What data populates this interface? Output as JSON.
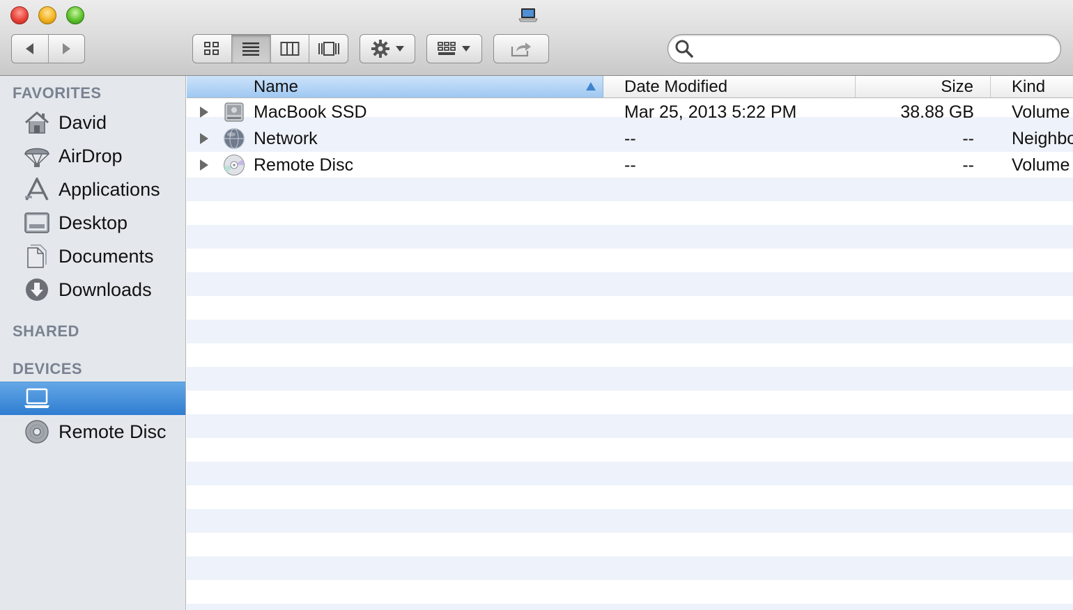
{
  "window": {
    "title_icon": "laptop-icon",
    "buttons": [
      "close",
      "minimize",
      "zoom"
    ]
  },
  "toolbar": {
    "nav": {
      "back_icon": "back-arrow-icon",
      "forward_icon": "forward-arrow-icon"
    },
    "view_modes": [
      "icon-view",
      "list-view",
      "column-view",
      "cover-flow-view"
    ],
    "active_view": "list-view",
    "action_icon": "gear-icon",
    "arrange_icon": "arrange-grid-icon",
    "share_icon": "share-icon",
    "search": {
      "placeholder": "",
      "value": ""
    }
  },
  "sidebar": {
    "favorites": {
      "header": "FAVORITES",
      "items": [
        {
          "label": "David",
          "icon": "home-icon"
        },
        {
          "label": "AirDrop",
          "icon": "airdrop-icon"
        },
        {
          "label": "Applications",
          "icon": "applications-icon"
        },
        {
          "label": "Desktop",
          "icon": "desktop-folder-icon"
        },
        {
          "label": "Documents",
          "icon": "documents-icon"
        },
        {
          "label": "Downloads",
          "icon": "downloads-icon"
        }
      ]
    },
    "shared": {
      "header": "SHARED"
    },
    "devices": {
      "header": "DEVICES",
      "items": [
        {
          "label": "",
          "icon": "laptop-icon",
          "selected": true
        },
        {
          "label": "Remote Disc",
          "icon": "disc-icon",
          "selected": false
        }
      ]
    }
  },
  "list": {
    "columns": {
      "name": "Name",
      "date": "Date Modified",
      "size": "Size",
      "kind": "Kind"
    },
    "sort": {
      "column": "name",
      "direction": "ascending"
    },
    "rows": [
      {
        "name": "MacBook SSD",
        "date": "Mar 25, 2013 5:22 PM",
        "size": "38.88 GB",
        "kind": "Volume",
        "icon": "hard-drive-icon"
      },
      {
        "name": "Network",
        "date": "--",
        "size": "--",
        "kind": "Neighbo",
        "icon": "network-globe-icon"
      },
      {
        "name": "Remote Disc",
        "date": "--",
        "size": "--",
        "kind": "Volume",
        "icon": "disc-icon"
      }
    ]
  },
  "colors": {
    "selection": "#3a86d6",
    "header_sorted": "#b3d4f5",
    "sidebar_bg": "#e4e8ed",
    "row_alt": "#eef2fa"
  }
}
